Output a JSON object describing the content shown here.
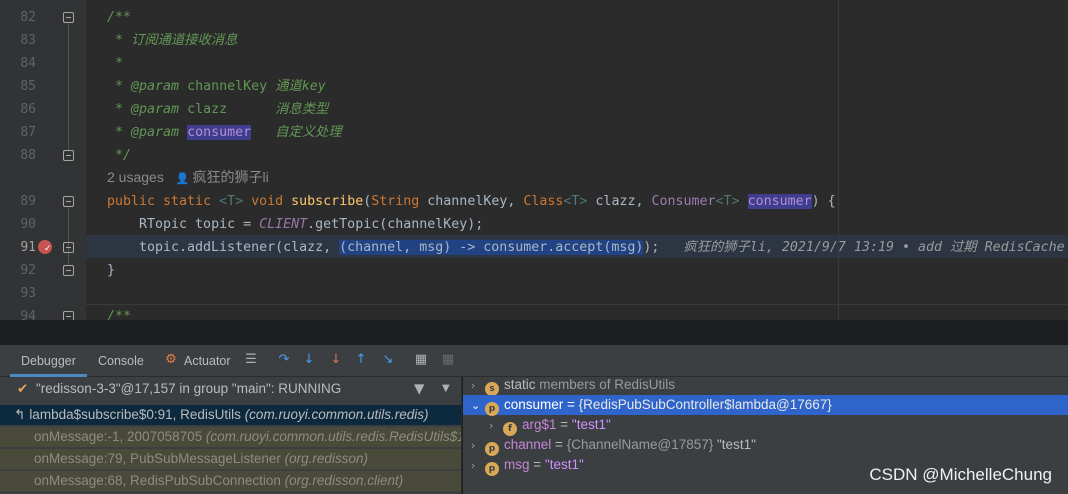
{
  "editor": {
    "line_numbers": [
      "82",
      "83",
      "84",
      "85",
      "86",
      "87",
      "88",
      "89",
      "90",
      "91",
      "92",
      "93",
      "94"
    ],
    "lines": {
      "l82": "/**",
      "l83": " * 订阅通道接收消息",
      "l84": " *",
      "l85_tag": " * @param ",
      "l85_param": "channelKey",
      "l85_desc": " 通道key",
      "l86_tag": " * @param ",
      "l86_param": "clazz",
      "l86_desc": "      消息类型",
      "l87_tag": " * @param ",
      "l87_param": "consumer",
      "l87_desc": "   自定义处理",
      "l88": " */",
      "l89": {
        "public": "public static ",
        "tp1": "<T>",
        "void": " void ",
        "fn": "subscribe",
        "open": "(",
        "string": "String",
        "p1": " channelKey, ",
        "class": "Class",
        "tp2": "<T>",
        "p2": " clazz, ",
        "consumer_t": "Consumer",
        "tp3": "<T>",
        "sp": " ",
        "p3": "consumer",
        "close": ") {"
      },
      "l90": {
        "type": "RTopic",
        "var": " topic = ",
        "client": "CLIENT",
        "call": ".getTopic(channelKey);"
      },
      "l91": {
        "pre": "topic.addListener(clazz, ",
        "lambda": "(channel, msg) -> consumer.accept(msg)",
        "post": ");",
        "blame": "   疯狂的狮子li, 2021/9/7 13:19 • add 过期 RedisCache"
      },
      "l92": "}",
      "l94": "/**"
    },
    "inlay_usages": "2 usages",
    "inlay_author": "疯狂的狮子li"
  },
  "toolwindow": {
    "tabs": [
      "Debugger",
      "Console",
      "Actuator"
    ],
    "active_tab": "Debugger"
  },
  "frames": {
    "thread": "\"redisson-3-3\"@17,157 in group \"main\": RUNNING",
    "items": [
      {
        "method": "lambda$subscribe$0:91, RedisUtils ",
        "pkg": "(com.ruoyi.common.utils.redis)"
      },
      {
        "method": "onMessage:-1, 2007058705 ",
        "pkg": "(com.ruoyi.common.utils.redis.RedisUtils$1"
      },
      {
        "method": "onMessage:79, PubSubMessageListener ",
        "pkg": "(org.redisson)"
      },
      {
        "method": "onMessage:68, RedisPubSubConnection ",
        "pkg": "(org.redisson.client)"
      }
    ]
  },
  "variables": {
    "items": [
      {
        "badge": "s",
        "name": "static",
        "rest": " members of RedisUtils"
      },
      {
        "badge": "p",
        "name": "consumer",
        "eq": " = ",
        "val": "{RedisPubSubController$lambda@17667}"
      },
      {
        "badge": "f",
        "name": "arg$1",
        "eq": " = ",
        "val": "\"test1\""
      },
      {
        "badge": "p",
        "name": "channel",
        "eq": " = ",
        "val": "{ChannelName@17857} ",
        "val2": "\"test1\""
      },
      {
        "badge": "p",
        "name": "msg",
        "eq": " = ",
        "val": "\"test1\""
      }
    ]
  },
  "watermark": "CSDN @MichelleChung",
  "colors": {
    "accent": "#2f65ca",
    "breakpoint": "#c75450"
  }
}
